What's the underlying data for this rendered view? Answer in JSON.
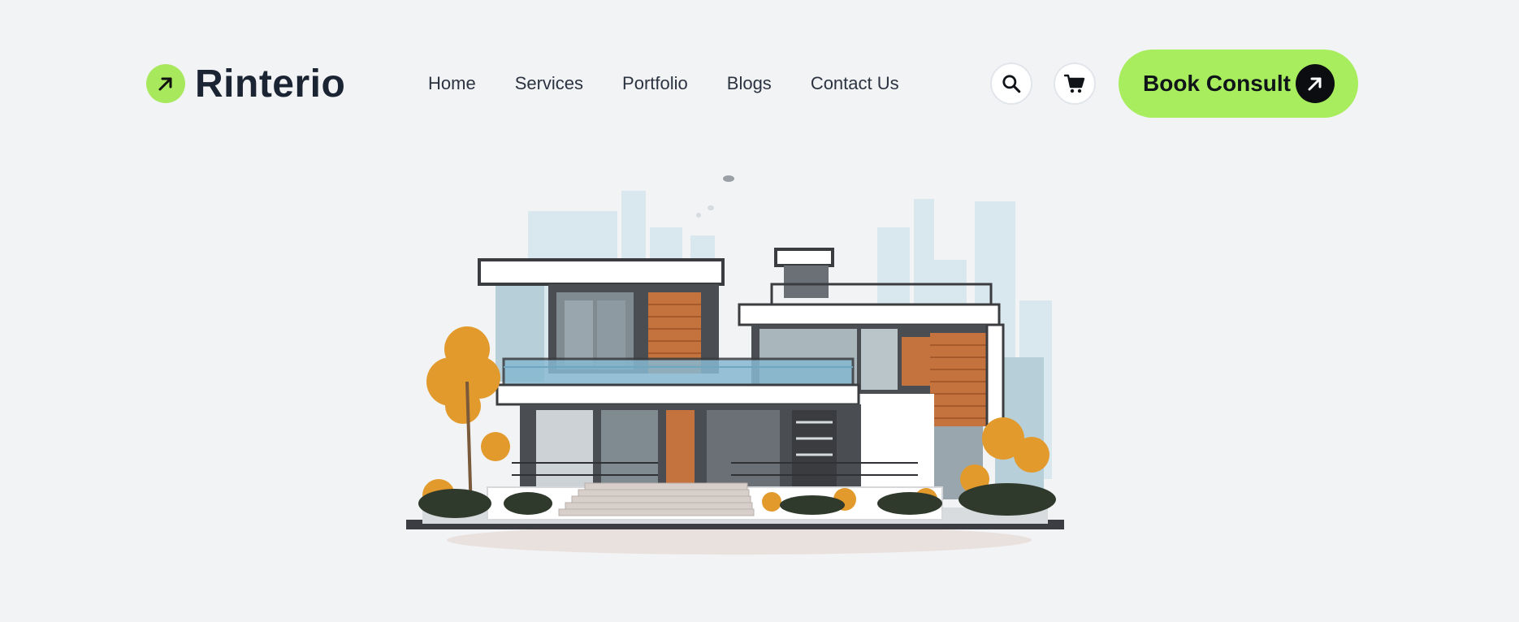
{
  "brand": {
    "name": "Rinterio",
    "logo_icon": "arrow-up-right-icon",
    "accent": "#a8ed5e"
  },
  "nav": {
    "links": [
      {
        "label": "Home"
      },
      {
        "label": "Services"
      },
      {
        "label": "Portfolio"
      },
      {
        "label": "Blogs"
      },
      {
        "label": "Contact Us"
      }
    ]
  },
  "actions": {
    "search_icon": "search-icon",
    "cart_icon": "cart-icon",
    "cta_label": "Book Consult",
    "cta_icon": "arrow-up-right-icon"
  },
  "hero": {
    "image": "modern-house-illustration",
    "colors": {
      "background": "#f2f3f5",
      "wood": "#c5733e",
      "glass": "#86b8d0",
      "foliage": "#e29a2c"
    }
  }
}
